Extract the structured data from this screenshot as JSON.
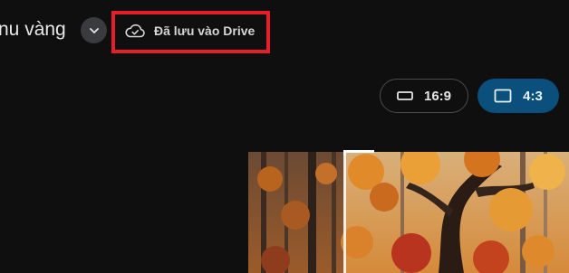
{
  "header": {
    "title": "nu vàng",
    "save_status": "Đã lưu vào Drive"
  },
  "icons": {
    "title_dropdown": "chevron-down-icon",
    "save_status": "cloud-done-icon",
    "ratio_shape": "rectangle-outline-icon"
  },
  "aspect_ratios": [
    {
      "label": "16:9",
      "selected": false
    },
    {
      "label": "4:3",
      "selected": true
    }
  ],
  "colors": {
    "background": "#0f0f10",
    "selected_ratio": "#0b4f7d",
    "highlight_border": "#e61e2a"
  }
}
